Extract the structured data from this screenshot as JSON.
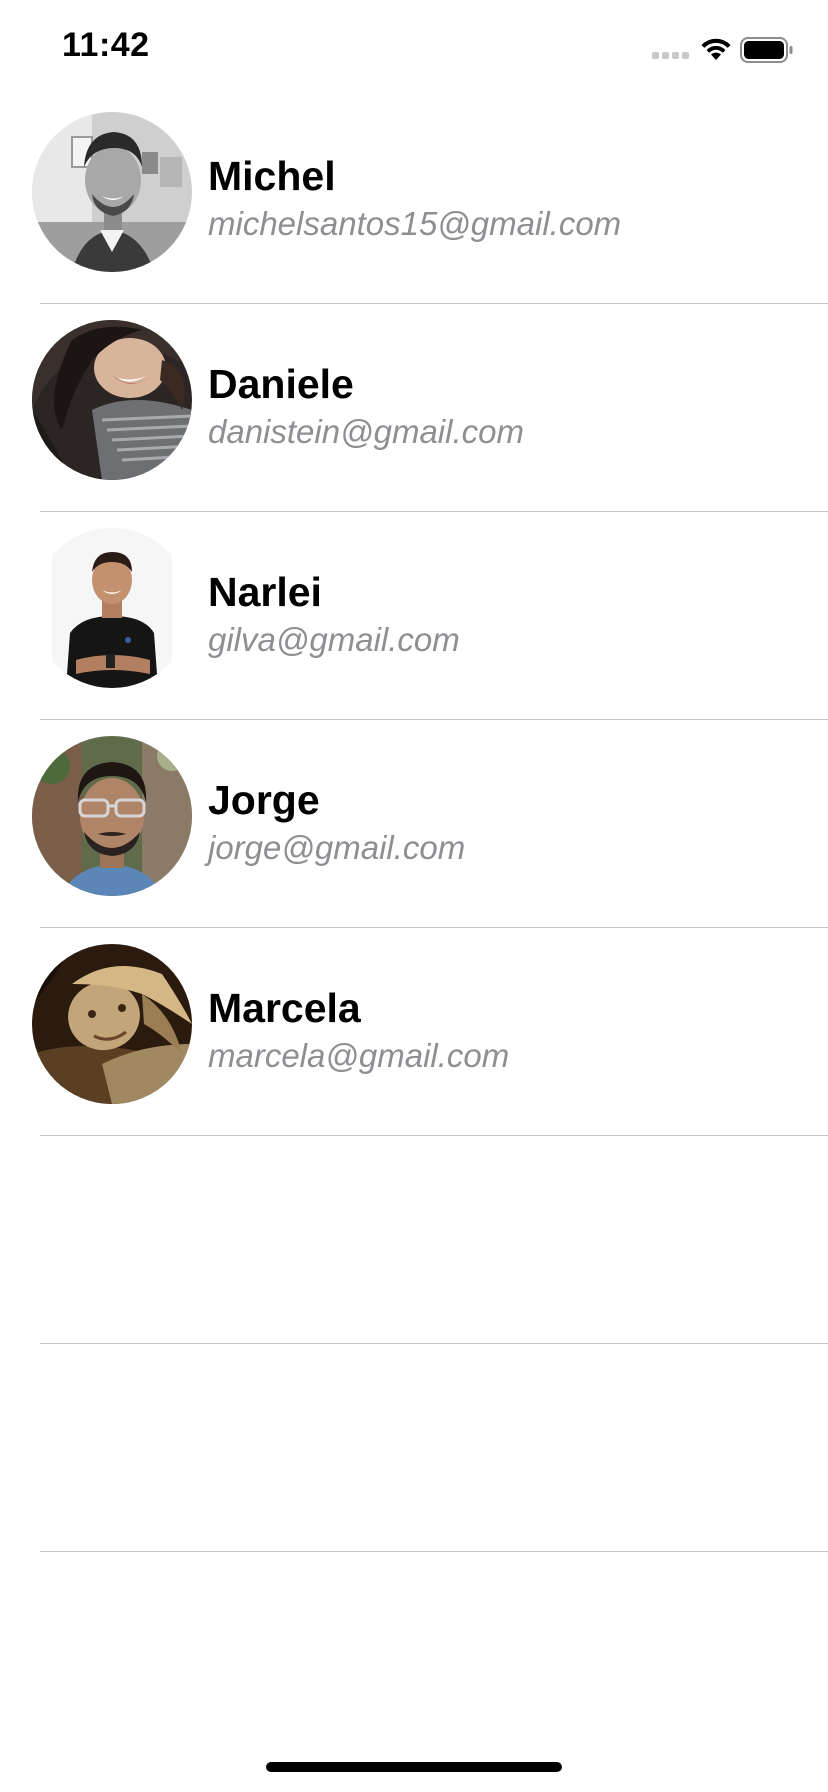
{
  "status_bar": {
    "time": "11:42",
    "icons": [
      "signal-icon",
      "wifi-icon",
      "battery-icon"
    ]
  },
  "contacts": [
    {
      "name": "Michel",
      "email": "michelsantos15@gmail.com",
      "avatar": "michel-photo"
    },
    {
      "name": "Daniele",
      "email": "danistein@gmail.com",
      "avatar": "daniele-photo"
    },
    {
      "name": "Narlei",
      "email": "gilva@gmail.com",
      "avatar": "narlei-photo"
    },
    {
      "name": "Jorge",
      "email": "jorge@gmail.com",
      "avatar": "jorge-photo"
    },
    {
      "name": "Marcela",
      "email": "marcela@gmail.com",
      "avatar": "marcela-photo"
    }
  ],
  "colors": {
    "separator": "#c8c7cc",
    "secondary_text": "#8e8e93",
    "primary_text": "#000000",
    "background": "#ffffff"
  }
}
